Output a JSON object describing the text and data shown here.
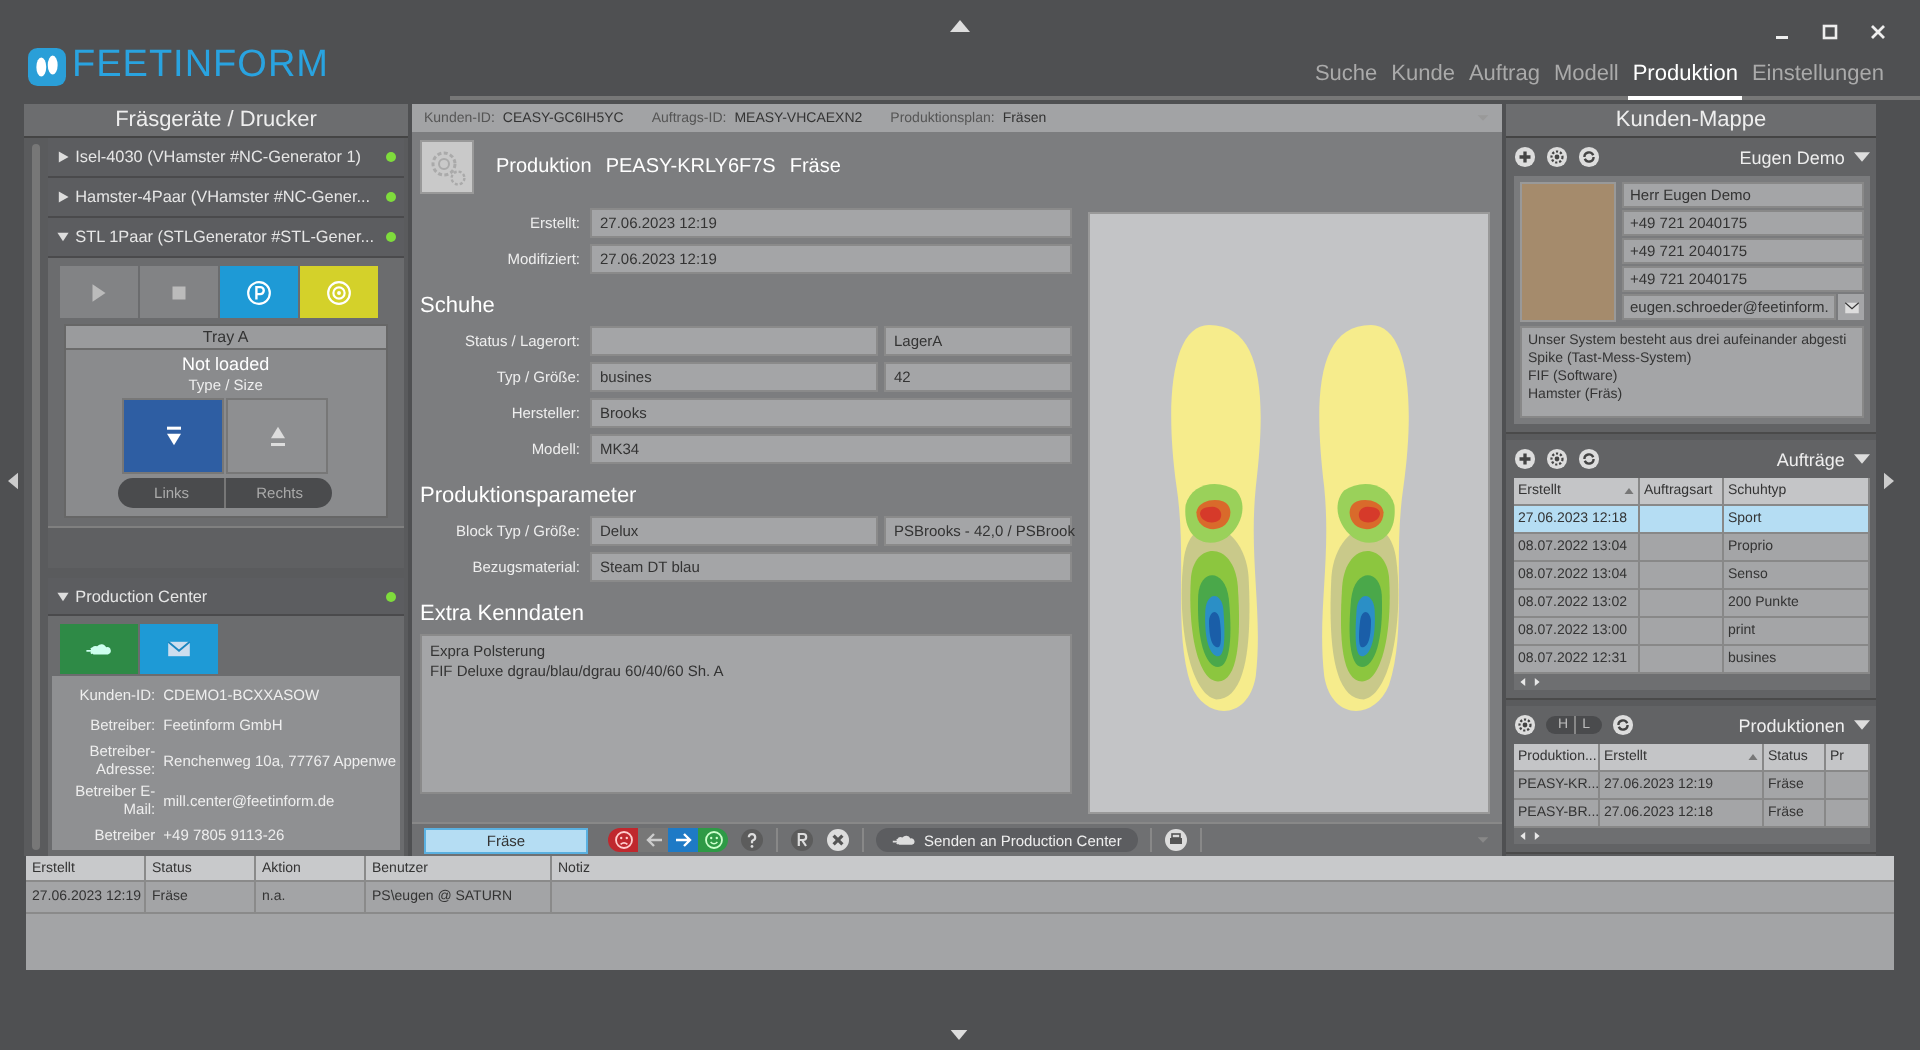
{
  "header": {
    "logo": "FEETINFORM",
    "nav": [
      {
        "label": "Suche",
        "selected": false
      },
      {
        "label": "Kunde",
        "selected": false
      },
      {
        "label": "Auftrag",
        "selected": false
      },
      {
        "label": "Modell",
        "selected": false
      },
      {
        "label": "Produktion",
        "selected": true
      },
      {
        "label": "Einstellungen",
        "selected": false
      }
    ]
  },
  "left_panel": {
    "title": "Fräsgeräte / Drucker",
    "devices": [
      {
        "label": "Isel-4030 (VHamster #NC-Generator 1)",
        "expanded": false,
        "online": true
      },
      {
        "label": "Hamster-4Paar (VHamster #NC-Gener...",
        "expanded": false,
        "online": true
      },
      {
        "label": "STL 1Paar (STLGenerator #STL-Gener...",
        "expanded": true,
        "online": true
      }
    ],
    "device_buttons": [
      {
        "kind": "play",
        "disabled": true
      },
      {
        "kind": "stop",
        "disabled": true
      },
      {
        "kind": "p",
        "disabled": false
      },
      {
        "kind": "target",
        "disabled": false
      }
    ],
    "tray": {
      "title": "Tray A",
      "status": "Not loaded",
      "type": "Type / Size",
      "sides": [
        {
          "label": "Links",
          "selected": true
        },
        {
          "label": "Rechts",
          "selected": false
        }
      ]
    },
    "production_center": {
      "title": "Production Center",
      "expanded": true,
      "online": true,
      "fields": [
        {
          "label": "Kunden-ID:",
          "value": "CDEMO1-BCXXASOW"
        },
        {
          "label": "Betreiber:",
          "value": "Feetinform GmbH"
        },
        {
          "label": "Betreiber-Adresse:",
          "value": "Renchenweg 10a, 77767 Appenwe"
        },
        {
          "label": "Betreiber E-Mail:",
          "value": "mill.center@feetinform.de"
        },
        {
          "label": "Betreiber",
          "value": "+49 7805 9113-26"
        }
      ]
    }
  },
  "center": {
    "info_bar": [
      {
        "label": "Kunden-ID:",
        "value": "CEASY-GC6IH5YC"
      },
      {
        "label": "Auftrags-ID:",
        "value": "MEASY-VHCAEXN2"
      },
      {
        "label": "Produktionsplan:",
        "value": "Fräsen"
      }
    ],
    "title": {
      "prefix": "Produktion",
      "id": "PEASY-KRLY6F7S",
      "type": "Fräse"
    },
    "meta": [
      {
        "label": "Erstellt:",
        "value": "27.06.2023 12:19"
      },
      {
        "label": "Modifiziert:",
        "value": "27.06.2023 12:19"
      }
    ],
    "sections": [
      {
        "title": "Schuhe",
        "rows": [
          {
            "label": "Status / Lagerort:",
            "extra": "LagerA"
          },
          {
            "label": "Typ / Größe:",
            "value": "busines",
            "extra": "42"
          },
          {
            "label": "Hersteller:",
            "value": "Brooks"
          },
          {
            "label": "Modell:",
            "value": "MK34"
          }
        ]
      },
      {
        "title": "Produktionsparameter",
        "rows": [
          {
            "label": "Block Typ / Größe:",
            "value": "Delux",
            "extra": "PSBrooks - 42,0 / PSBrook"
          },
          {
            "label": "Bezugsmaterial:",
            "value": "Steam DT blau"
          }
        ]
      }
    ],
    "extra": {
      "title": "Extra Kenndaten",
      "lines": [
        "Expra Polsterung",
        "FIF Deluxe dgrau/blau/dgrau 60/40/60 Sh. A"
      ]
    },
    "toolbar": {
      "status": "Fräse",
      "send_label": "Senden an Production Center"
    }
  },
  "right_panel": {
    "title": "Kunden-Mappe",
    "customer": {
      "name": "Eugen Demo",
      "fields": [
        "Herr Eugen Demo",
        "+49 721 2040175",
        "+49 721 2040175",
        "+49 721 2040175"
      ],
      "email": "eugen.schroeder@feetinform.",
      "notes": [
        "Unser System besteht aus drei aufeinander abgesti",
        "Spike (Tast-Mess-System)",
        "FIF (Software)",
        "Hamster (Fräs)"
      ]
    },
    "orders": {
      "title": "Aufträge",
      "columns": [
        "Erstellt",
        "Auftragsart",
        "Schuhtyp"
      ],
      "rows": [
        {
          "cells": [
            "27.06.2023 12:18",
            null,
            "Sport"
          ],
          "selected": true
        },
        {
          "cells": [
            "08.07.2022 13:04",
            null,
            "Proprio"
          ],
          "selected": false
        },
        {
          "cells": [
            "08.07.2022 13:04",
            null,
            "Senso"
          ],
          "selected": false
        },
        {
          "cells": [
            "08.07.2022 13:02",
            null,
            "200 Punkte"
          ],
          "selected": false
        },
        {
          "cells": [
            "08.07.2022 13:00",
            null,
            "print"
          ],
          "selected": false
        },
        {
          "cells": [
            "08.07.2022 12:31",
            null,
            "busines"
          ],
          "selected": false
        }
      ]
    },
    "productions": {
      "title": "Produktionen",
      "toggle": [
        "H",
        "L"
      ],
      "columns": [
        "Produktion...",
        "Erstellt",
        "Status",
        "Pr"
      ],
      "rows": [
        {
          "cells": [
            "PEASY-KR...",
            "27.06.2023 12:19",
            "Fräse",
            null
          ],
          "selected": false
        },
        {
          "cells": [
            "PEASY-BR...",
            "27.06.2023 12:18",
            "Fräse",
            null
          ],
          "selected": false
        }
      ]
    }
  },
  "log": {
    "columns": [
      "Erstellt",
      "Status",
      "Aktion",
      "Benutzer",
      "Notiz"
    ],
    "rows": [
      {
        "cells": [
          "27.06.2023 12:19",
          "Fräse",
          "n.a.",
          "PS\\eugen @ SATURN",
          null
        ]
      }
    ]
  }
}
